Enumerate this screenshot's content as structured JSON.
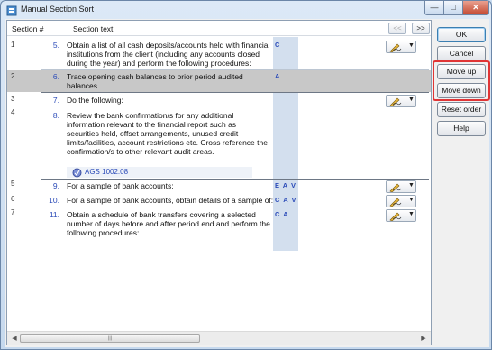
{
  "window": {
    "title": "Manual Section Sort",
    "min": "—",
    "max": "□",
    "close": "✕"
  },
  "header": {
    "section_col": "Section #",
    "text_col": "Section text",
    "prev": "<<",
    "next": ">>"
  },
  "rows": [
    {
      "section": "1",
      "number": "5.",
      "text": "Obtain a list of all cash deposits/accounts held with financial institutions from the client (including any accounts closed during the year) and perform the following procedures:",
      "code": "C",
      "signoff": true,
      "selected": false
    },
    {
      "section": "2",
      "number": "6.",
      "text": "Trace opening cash balances to prior period audited balances.",
      "code": "A",
      "signoff": false,
      "selected": true
    },
    {
      "section": "3",
      "number": "7.",
      "text": "Do the following:",
      "code": "",
      "signoff": true,
      "selected": false
    },
    {
      "section": "4",
      "number": "8.",
      "text": "Review the bank confirmation/s for any additional information relevant to the financial report such as securities held, offset arrangements, unused credit limits/facilities, account restrictions etc. Cross reference the confirmation/s to other relevant audit areas.",
      "code": "",
      "signoff": false,
      "selected": false
    },
    {
      "section": "5",
      "number": "9.",
      "text": "For a sample of bank accounts:",
      "code": "E A V",
      "signoff": true,
      "selected": false
    },
    {
      "section": "6",
      "number": "10.",
      "text": "For a sample of bank accounts, obtain details of a sample of:",
      "code": "C A V",
      "signoff": true,
      "selected": false
    },
    {
      "section": "7",
      "number": "11.",
      "text": "Obtain a schedule of bank transfers covering a selected number of days before and after period end and perform the following procedures:",
      "code": "C A",
      "signoff": true,
      "selected": false
    }
  ],
  "reference": {
    "label": "AGS 1002.08",
    "icon": "reference-link-icon"
  },
  "scrollbar": {
    "left": "◀",
    "right": "▶",
    "grip": "|||"
  },
  "buttons": {
    "ok": "OK",
    "cancel": "Cancel",
    "move_up": "Move up",
    "move_down": "Move down",
    "reset_order": "Reset order",
    "help": "Help"
  },
  "colors": {
    "accent_blue": "#2b4bb8",
    "selected_row": "#c8c8c8",
    "code_column": "#d3dfee",
    "highlight": "#e03535"
  }
}
